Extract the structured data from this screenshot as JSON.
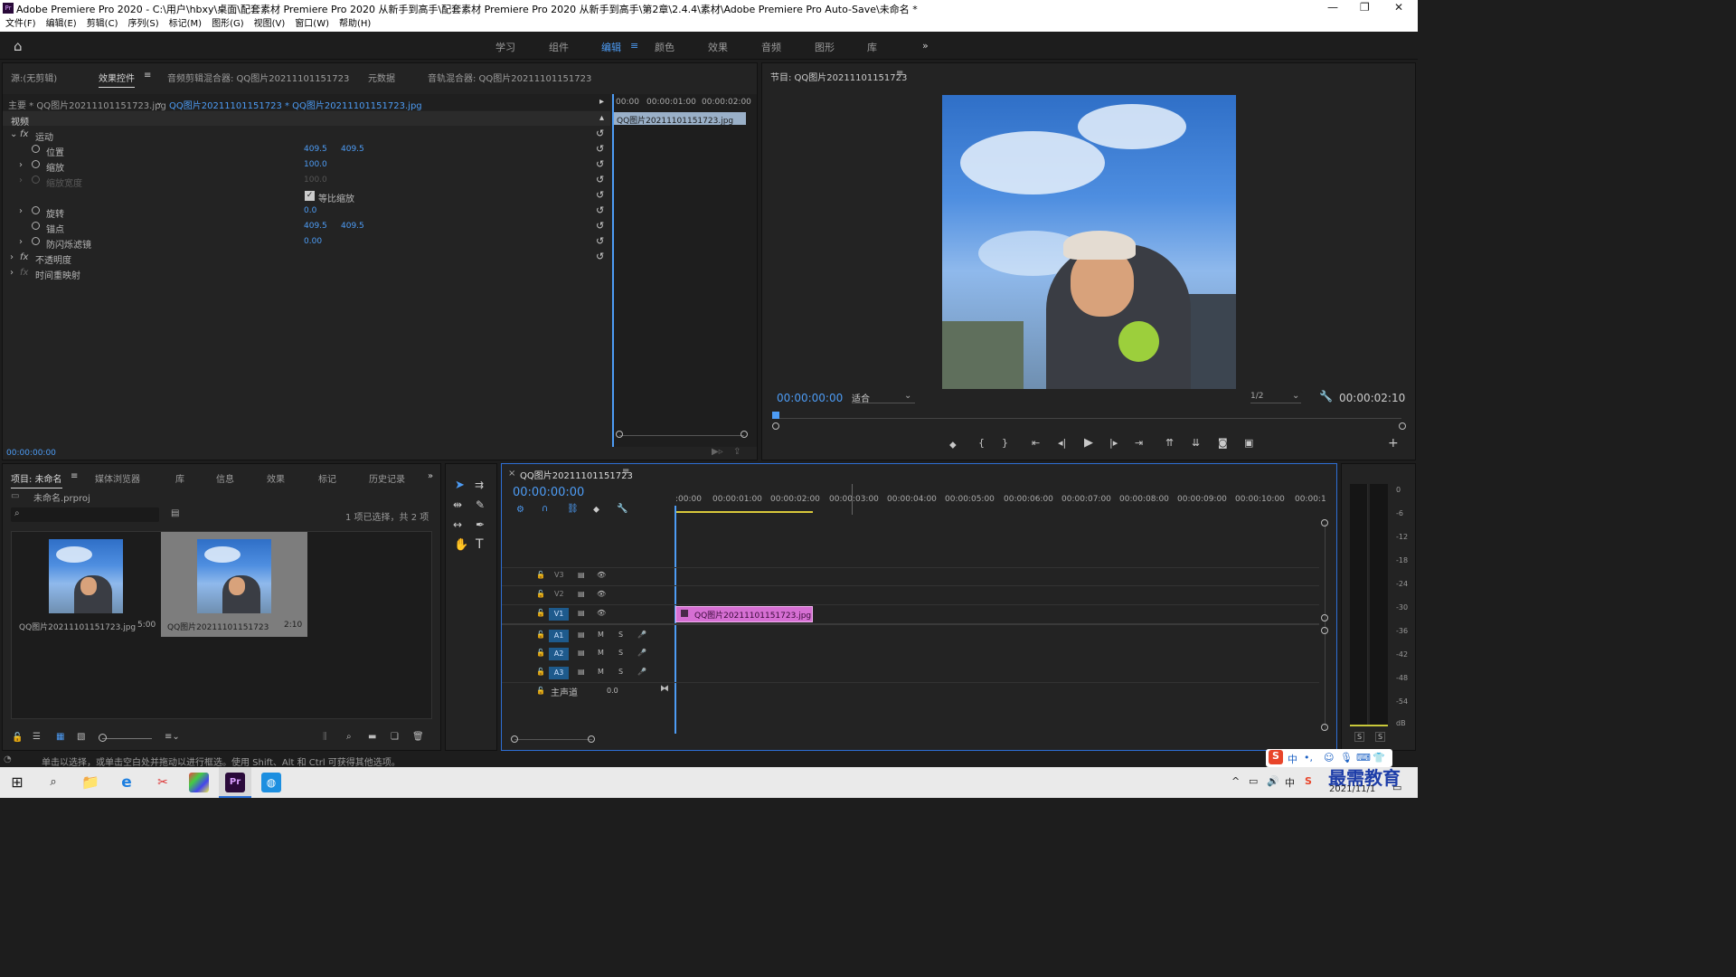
{
  "window": {
    "title": "Adobe Premiere Pro 2020 - C:\\用户\\hbxy\\桌面\\配套素材 Premiere Pro 2020 从新手到高手\\配套素材 Premiere Pro 2020 从新手到高手\\第2章\\2.4.4\\素材\\Adobe Premiere Pro Auto-Save\\未命名 *",
    "logo": "Pr"
  },
  "menu": [
    "文件(F)",
    "编辑(E)",
    "剪辑(C)",
    "序列(S)",
    "标记(M)",
    "图形(G)",
    "视图(V)",
    "窗口(W)",
    "帮助(H)"
  ],
  "workspaces": {
    "items": [
      "学习",
      "组件",
      "编辑",
      "颜色",
      "效果",
      "音频",
      "图形",
      "库"
    ],
    "active": "编辑",
    "more": "»"
  },
  "source_panel": {
    "tabs": [
      "源:(无剪辑)",
      "效果控件",
      "音频剪辑混合器: QQ图片20211101151723",
      "元数据",
      "音轨混合器: QQ图片20211101151723"
    ],
    "active_tab": "效果控件",
    "master": "主要 * QQ图片20211101151723.jpg",
    "sequence": "QQ图片20211101151723 * QQ图片20211101151723.jpg",
    "video_label": "视频",
    "ruler": [
      "00:00",
      "00:00:01:00",
      "00:00:02:00"
    ],
    "clip_name": "QQ图片20211101151723.jpg",
    "timecode": "00:00:00:00",
    "effects": [
      {
        "name": "运动",
        "fx": true
      },
      {
        "name": "位置",
        "v1": "409.5",
        "v2": "409.5"
      },
      {
        "name": "缩放",
        "v1": "100.0",
        "v2": ""
      },
      {
        "name": "缩放宽度",
        "v1": "100.0",
        "v2": "",
        "disabled": true
      },
      {
        "name": "等比缩放",
        "checkbox": true
      },
      {
        "name": "旋转",
        "v1": "0.0",
        "v2": ""
      },
      {
        "name": "锚点",
        "v1": "409.5",
        "v2": "409.5"
      },
      {
        "name": "防闪烁滤镜",
        "v1": "0.00",
        "v2": ""
      },
      {
        "name": "不透明度",
        "fx": true
      },
      {
        "name": "时间重映射",
        "fx": true
      }
    ]
  },
  "program": {
    "title": "节目: QQ图片20211101151723",
    "timecode": "00:00:00:00",
    "fit": "适合",
    "quality": "1/2",
    "duration": "00:00:02:10"
  },
  "project": {
    "tabs": [
      "项目: 未命名",
      "媒体浏览器",
      "库",
      "信息",
      "效果",
      "标记",
      "历史记录"
    ],
    "file": "未命名.prproj",
    "selection": "1 项已选择，共 2 项",
    "items": [
      {
        "name": "QQ图片20211101151723.jpg",
        "duration": "5:00"
      },
      {
        "name": "QQ图片20211101151723",
        "duration": "2:10"
      }
    ]
  },
  "timeline": {
    "title": "QQ图片20211101151723",
    "timecode": "00:00:00:00",
    "ruler": [
      ":00:00",
      "00:00:01:00",
      "00:00:02:00",
      "00:00:03:00",
      "00:00:04:00",
      "00:00:05:00",
      "00:00:06:00",
      "00:00:07:00",
      "00:00:08:00",
      "00:00:09:00",
      "00:00:10:00",
      "00:00:1"
    ],
    "video_tracks": [
      "V3",
      "V2",
      "V1"
    ],
    "audio_tracks": [
      "A1",
      "A2",
      "A3"
    ],
    "master": "主声道",
    "master_value": "0.0",
    "clip": "QQ图片20211101151723.jpg"
  },
  "meter": {
    "ticks": [
      "0",
      "-6",
      "-12",
      "-18",
      "-24",
      "-30",
      "-36",
      "-42",
      "-48",
      "-54",
      "dB"
    ],
    "solo": [
      "S",
      "S"
    ]
  },
  "status": "单击以选择，或单击空白处并拖动以进行框选。使用 Shift、Alt 和 Ctrl 可获得其他选项。",
  "ime": "中",
  "watermark": "最需教育",
  "clock": {
    "date": "2021/11/1"
  }
}
